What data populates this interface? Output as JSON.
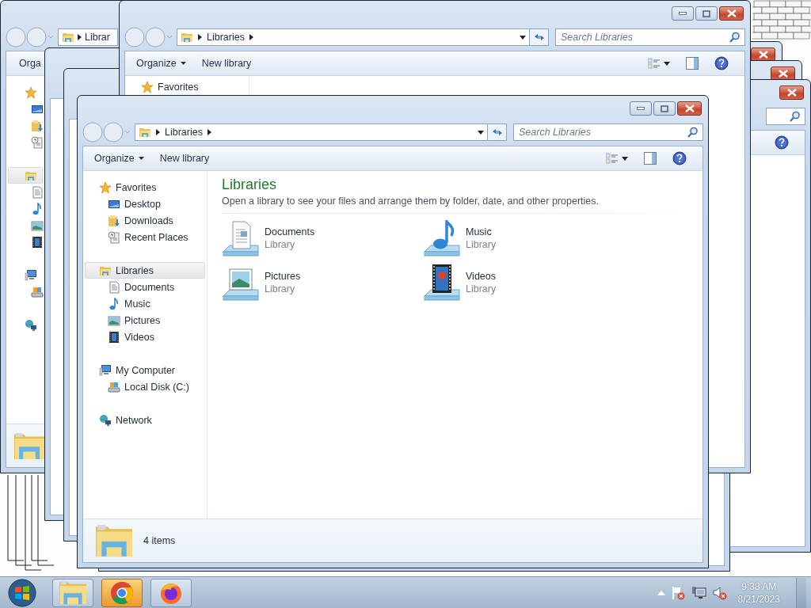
{
  "windows": [
    {
      "address": {
        "segments": [
          "Librar"
        ]
      },
      "toolbar": [
        "Orga"
      ],
      "nav": [
        {
          "kind": "favorites",
          "selected": false,
          "children": [
            {
              "kind": "desktop",
              "selected": false
            },
            {
              "kind": "downloads",
              "selected": false
            },
            {
              "kind": "recent",
              "selected": false
            }
          ]
        },
        {
          "kind": "libraries",
          "selected": true,
          "children": [
            {
              "kind": "documents",
              "selected": false
            },
            {
              "kind": "music",
              "selected": false
            },
            {
              "kind": "pictures",
              "selected": false
            },
            {
              "kind": "videos",
              "selected": false
            }
          ]
        },
        {
          "kind": "computer",
          "selected": false,
          "children": [
            {
              "kind": "disk",
              "selected": false
            }
          ]
        },
        {
          "kind": "network",
          "selected": false
        }
      ]
    },
    {
      "address": {
        "segments": [
          "Libraries"
        ]
      },
      "search": {
        "placeholder": "Search Libraries"
      },
      "toolbar": [
        "Organize",
        "New library"
      ],
      "nav": [
        {
          "label": "Favorites",
          "kind": "favorites",
          "selected": false
        }
      ]
    },
    {
      "address": {
        "segments": [
          "Libraries"
        ]
      },
      "search": {
        "placeholder": "Search Libraries"
      },
      "toolbar": [
        "Organize",
        "New library"
      ],
      "nav": [
        {
          "label": "Favorites",
          "kind": "favorites",
          "selected": false,
          "children": [
            {
              "label": "Desktop",
              "kind": "desktop",
              "selected": false
            },
            {
              "label": "Downloads",
              "kind": "downloads",
              "selected": false
            },
            {
              "label": "Recent Places",
              "kind": "recent",
              "selected": false
            }
          ]
        },
        {
          "label": "Libraries",
          "kind": "libraries",
          "selected": true,
          "children": [
            {
              "label": "Documents",
              "kind": "documents",
              "selected": false
            },
            {
              "label": "Music",
              "kind": "music",
              "selected": false
            },
            {
              "label": "Pictures",
              "kind": "pictures",
              "selected": false
            },
            {
              "label": "Videos",
              "kind": "videos",
              "selected": false
            }
          ]
        },
        {
          "label": "My Computer",
          "kind": "computer",
          "selected": false,
          "children": [
            {
              "label": "Local Disk (C:)",
              "kind": "disk",
              "selected": false
            }
          ]
        },
        {
          "label": "Network",
          "kind": "network",
          "selected": false
        }
      ],
      "content": {
        "heading": "Libraries",
        "description": "Open a library to see your files and arrange them by folder, date, and other properties.",
        "items": [
          {
            "name": "Documents",
            "type": "Library",
            "kind": "documents"
          },
          {
            "name": "Music",
            "type": "Library",
            "kind": "music"
          },
          {
            "name": "Pictures",
            "type": "Library",
            "kind": "pictures"
          },
          {
            "name": "Videos",
            "type": "Library",
            "kind": "videos"
          }
        ]
      },
      "status": "4 items"
    }
  ],
  "taskbar": {
    "apps": [
      {
        "kind": "explorer",
        "highlighted": false
      },
      {
        "kind": "chrome",
        "highlighted": true
      },
      {
        "kind": "firefox",
        "highlighted": false
      }
    ],
    "tray": [
      {
        "kind": "show_hidden"
      },
      {
        "kind": "action_center"
      },
      {
        "kind": "network"
      },
      {
        "kind": "volume"
      }
    ],
    "time": "9:38 AM",
    "date": "8/21/2023"
  }
}
